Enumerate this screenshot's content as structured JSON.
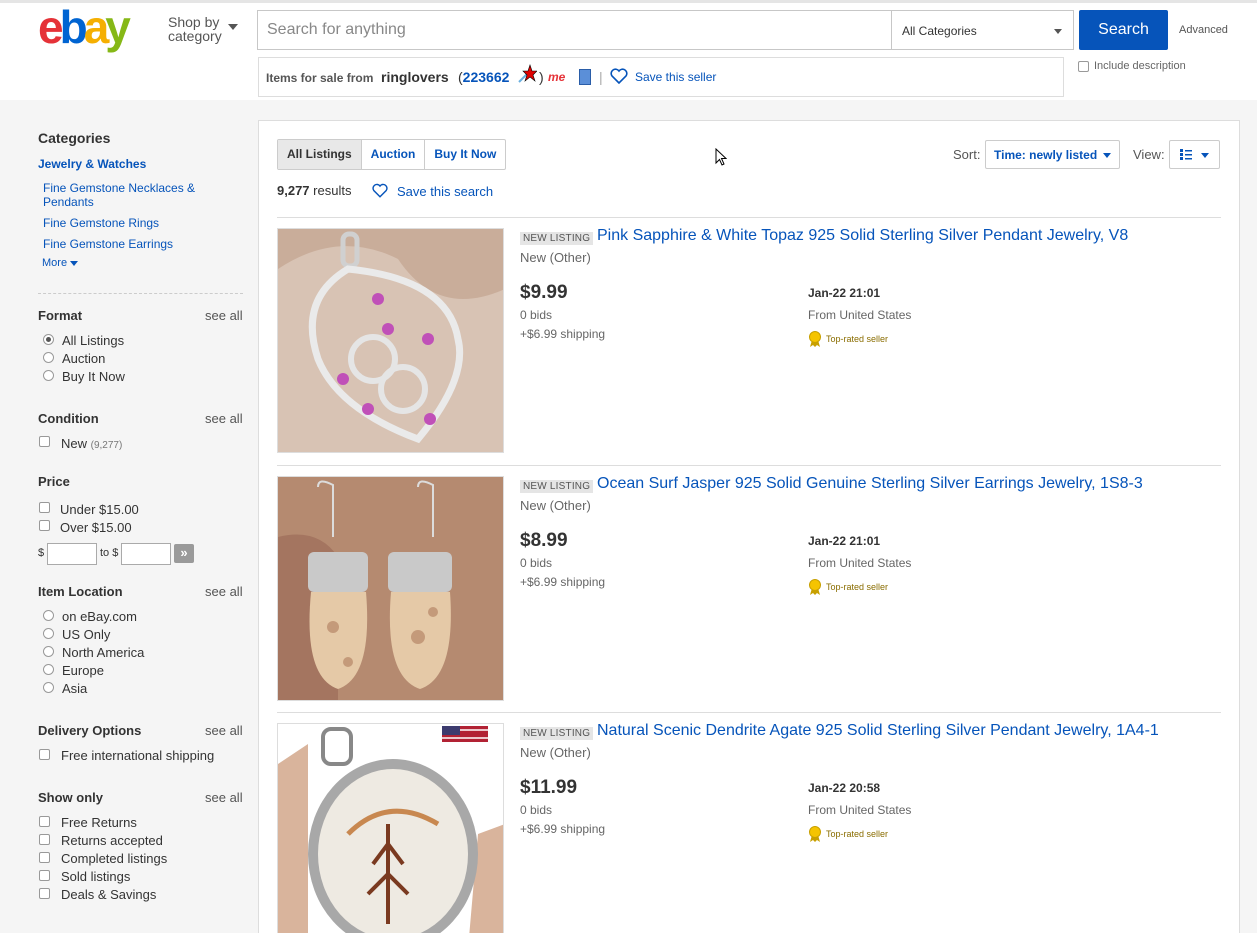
{
  "header": {
    "logo_text": "ebay",
    "shop_by": "Shop by",
    "shop_by_2": "category",
    "search_placeholder": "Search for anything",
    "category_select": "All Categories",
    "search_button": "Search",
    "advanced": "Advanced",
    "include_description": "Include description",
    "brand_colors": {
      "e": "#e53238",
      "b": "#0064d2",
      "a": "#f5af02",
      "y": "#86b817"
    }
  },
  "seller_bar": {
    "label": "Items for sale from",
    "seller_name": "ringlovers",
    "feedback_prefix": "(",
    "feedback_score": "223662",
    "feedback_suffix": ")",
    "separator": "|",
    "me_badge": "me",
    "save_seller": "Save this seller"
  },
  "sidebar": {
    "categories_title": "Categories",
    "main_category": "Jewelry & Watches",
    "subcategories": [
      "Fine Gemstone Necklaces &",
      "Pendants",
      "Fine Gemstone Rings",
      "Fine Gemstone Earrings"
    ],
    "more": "More",
    "format": {
      "title": "Format",
      "see_all": "see all",
      "options": [
        "All Listings",
        "Auction",
        "Buy It Now"
      ],
      "selected": "All Listings"
    },
    "condition": {
      "title": "Condition",
      "see_all": "see all",
      "options": [
        {
          "label": "New",
          "count": "(9,277)"
        }
      ]
    },
    "price": {
      "title": "Price",
      "options": [
        "Under $15.00",
        "Over $15.00"
      ],
      "currency": "$",
      "to": "to $"
    },
    "item_location": {
      "title": "Item Location",
      "see_all": "see all",
      "options": [
        "on eBay.com",
        "US Only",
        "North America",
        "Europe",
        "Asia"
      ]
    },
    "delivery": {
      "title": "Delivery Options",
      "see_all": "see all",
      "options": [
        "Free international shipping"
      ]
    },
    "show_only": {
      "title": "Show only",
      "see_all": "see all",
      "options": [
        "Free Returns",
        "Returns accepted",
        "Completed listings",
        "Sold listings",
        "Deals & Savings"
      ]
    }
  },
  "results_bar": {
    "tabs": [
      "All Listings",
      "Auction",
      "Buy It Now"
    ],
    "active_tab": "All Listings",
    "results_count": "9,277",
    "results_word": "results",
    "save_search": "Save this search",
    "sort_label": "Sort:",
    "sort_value": "Time: newly listed",
    "view_label": "View:",
    "view_mode": "list-icon"
  },
  "listings": [
    {
      "badge": "NEW LISTING",
      "title": "Pink Sapphire & White Topaz 925 Solid Sterling Silver Pendant Jewelry, V8",
      "condition": "New (Other)",
      "price": "$9.99",
      "bids": "0 bids",
      "shipping": "+$6.99 shipping",
      "time": "Jan-22 21:01",
      "from": "From United States",
      "seller_badge": "Top-rated seller"
    },
    {
      "badge": "NEW LISTING",
      "title": "Ocean Surf Jasper 925 Solid Genuine Sterling Silver Earrings Jewelry, 1S8-3",
      "condition": "New (Other)",
      "price": "$8.99",
      "bids": "0 bids",
      "shipping": "+$6.99 shipping",
      "time": "Jan-22 21:01",
      "from": "From United States",
      "seller_badge": "Top-rated seller"
    },
    {
      "badge": "NEW LISTING",
      "title": "Natural Scenic Dendrite Agate 925 Solid Sterling Silver Pendant Jewelry, 1A4-1",
      "condition": "New (Other)",
      "price": "$11.99",
      "bids": "0 bids",
      "shipping": "+$6.99 shipping",
      "time": "Jan-22 20:58",
      "from": "From United States",
      "seller_badge": "Top-rated seller"
    }
  ]
}
